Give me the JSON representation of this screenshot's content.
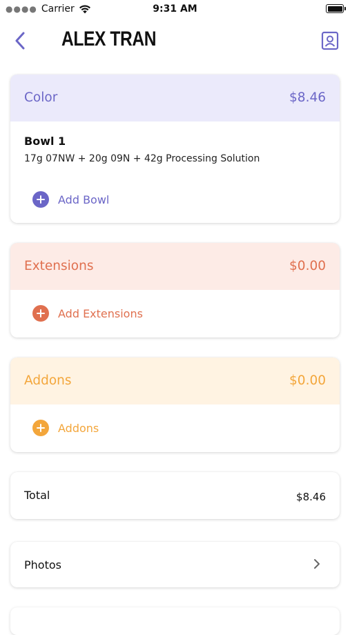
{
  "status_bar": {
    "carrier": "Carrier",
    "time": "9:31 AM"
  },
  "nav": {
    "title": "ALEX TRAN",
    "back_icon": "chevron-left-icon",
    "profile_icon": "contact-card-icon",
    "accent_color": "#6b66c7"
  },
  "color_section": {
    "title": "Color",
    "amount": "$8.46",
    "header_bg": "#ebeafb",
    "accent": "#6b66c7",
    "bowls": [
      {
        "title": "Bowl 1",
        "detail": "17g 07NW + 20g 09N + 42g Processing Solution"
      }
    ],
    "add_label": "Add Bowl"
  },
  "extensions_section": {
    "title": "Extensions",
    "amount": "$0.00",
    "header_bg": "#fdebe6",
    "accent": "#e0704f",
    "add_label": "Add Extensions"
  },
  "addons_section": {
    "title": "Addons",
    "amount": "$0.00",
    "header_bg": "#fff3e2",
    "accent": "#f3a63b",
    "add_label": "Addons"
  },
  "total": {
    "label": "Total",
    "value": "$8.46"
  },
  "photos": {
    "label": "Photos",
    "chevron_icon": "chevron-right-icon"
  }
}
